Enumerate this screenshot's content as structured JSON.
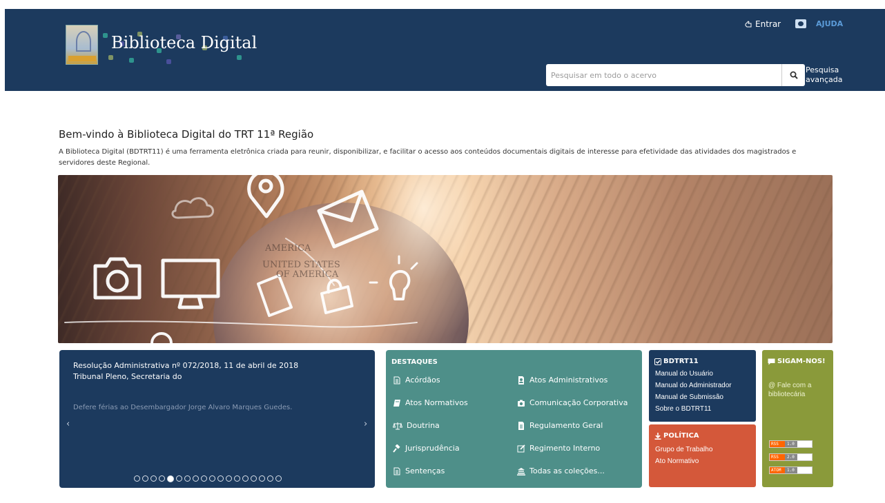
{
  "header": {
    "logo_text": "Biblioteca Digital",
    "entrar_label": "Entrar",
    "ajuda_label": "AJUDA",
    "search_placeholder": "Pesquisar em todo o acervo",
    "advanced_line1": "Pesquisa",
    "advanced_line2": "avançada"
  },
  "welcome": {
    "title": "Bem-vindo à Biblioteca Digital do TRT 11ª Região",
    "text": "A Biblioteca Digital (BDTRT11) é uma ferramenta eletrônica criada para reunir, disponibilizar, e facilitar o acesso aos conteúdos documentais digitais de interesse para efetividade das atividades dos magistrados e servidores deste Regional."
  },
  "carousel": {
    "title_line1": "Resolução Administrativa nº 072/2018, 11 de abril de 2018",
    "title_line2": "Tribunal Pleno, Secretaria do",
    "description": "Defere férias ao Desembargador Jorge Alvaro Marques Guedes.",
    "prev": "‹",
    "next": "›",
    "slide_count": 18,
    "active_slide": 4
  },
  "destaques": {
    "title": "DESTAQUES",
    "items": [
      {
        "label": "Acórdãos",
        "icon": "file-text-icon"
      },
      {
        "label": "Atos Administrativos",
        "icon": "user-file-icon"
      },
      {
        "label": "Atos Normativos",
        "icon": "book-icon"
      },
      {
        "label": "Comunicação Corporativa",
        "icon": "camera-icon"
      },
      {
        "label": "Doutrina",
        "icon": "scale-icon"
      },
      {
        "label": "Regulamento Geral",
        "icon": "document-icon"
      },
      {
        "label": "Jurisprudência",
        "icon": "gavel-icon"
      },
      {
        "label": "Regimento Interno",
        "icon": "edit-icon"
      },
      {
        "label": "Sentenças",
        "icon": "file-text-icon"
      },
      {
        "label": "Todas as coleções...",
        "icon": "collections-icon"
      }
    ]
  },
  "bdtrt": {
    "title": "BDTRT11",
    "links": [
      "Manual do Usuário",
      "Manual do Administrador",
      "Manual de Submissão",
      "Sobre o BDTRT11"
    ]
  },
  "politica": {
    "title": "POLÍTICA",
    "links": [
      "Grupo de Trabalho",
      "Ato Normativo"
    ]
  },
  "sigam": {
    "title": "SIGAM-NOS!",
    "contact_line1": "@ Fale com a",
    "contact_line2": "bibliotecária",
    "feeds": [
      {
        "key": "RSS",
        "ver": "1.0"
      },
      {
        "key": "RSS",
        "ver": "2.0"
      },
      {
        "key": "ATOM",
        "ver": "1.0"
      }
    ]
  },
  "colors": {
    "header_bg": "#1c3a5e",
    "destaques_bg": "#4e8f89",
    "politica_bg": "#d4583a",
    "sigam_bg": "#8a9a3a",
    "ajuda_color": "#5b9bd8"
  }
}
